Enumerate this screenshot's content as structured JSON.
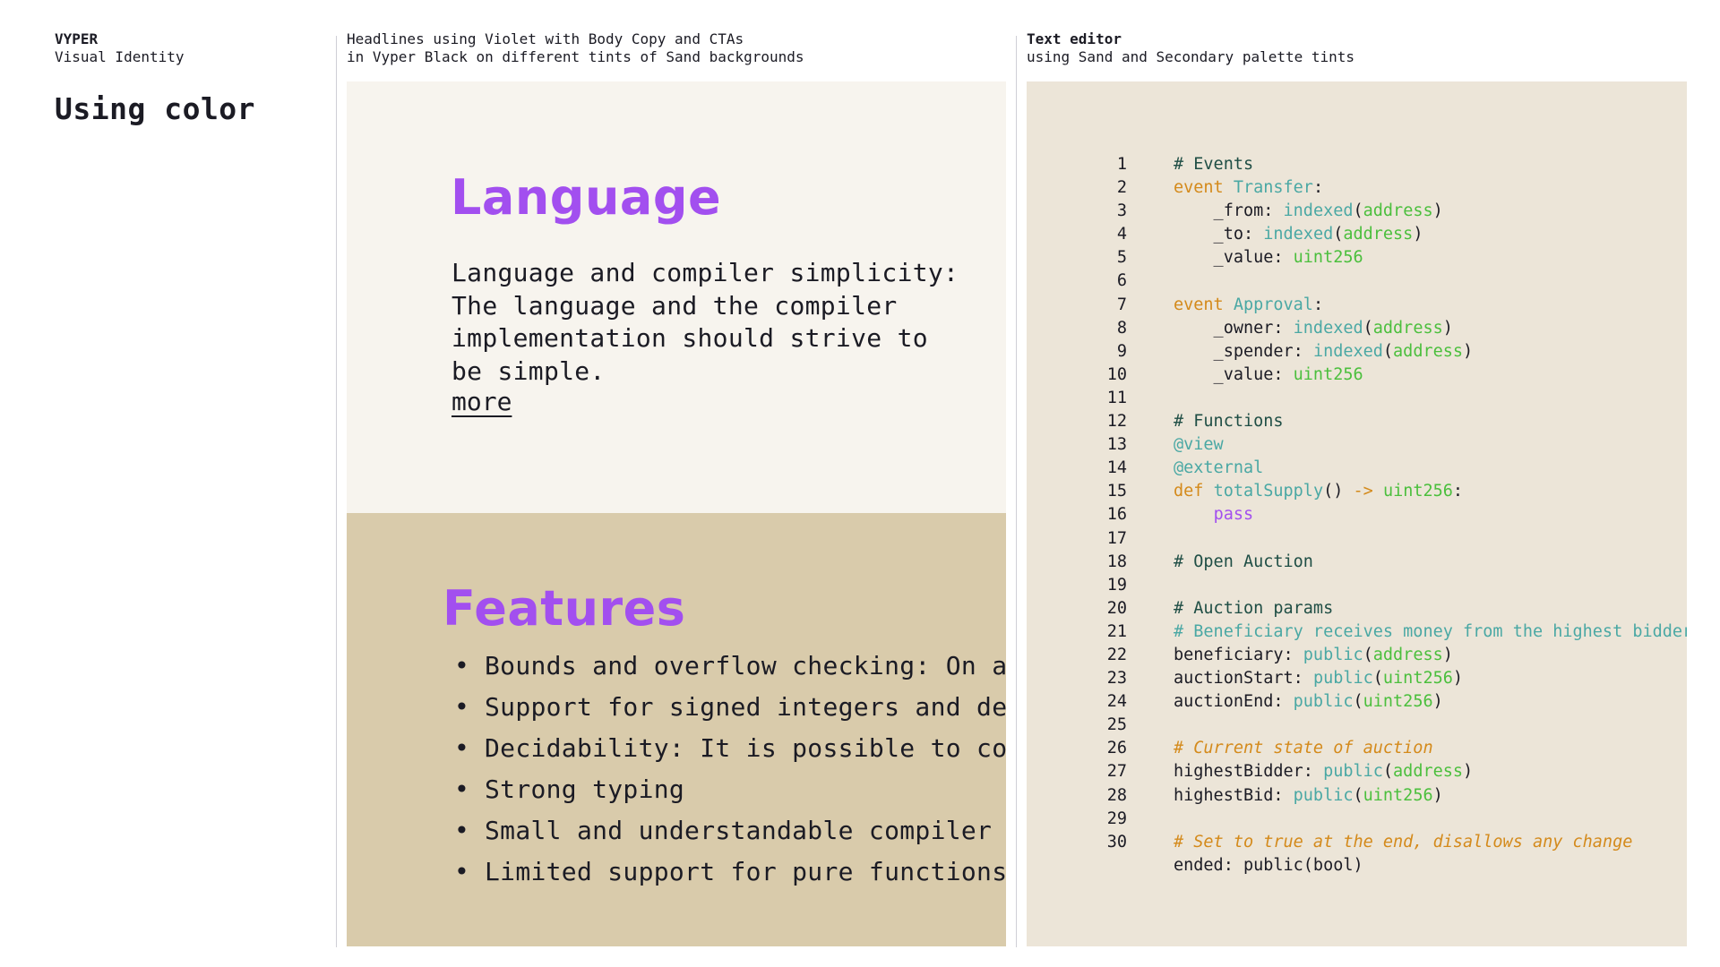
{
  "brand": {
    "name": "VYPER",
    "subtitle": "Visual Identity"
  },
  "page_title": "Using color",
  "middle": {
    "caption_line1": "Headlines using Violet with Body Copy and CTAs",
    "caption_line2": "in Vyper Black on different tints of Sand backgrounds",
    "language": {
      "heading": "Language",
      "body": "Language and compiler simplicity: The language and the compiler implementation should strive to be simple.",
      "more_label": "more"
    },
    "features": {
      "heading": "Features",
      "bullet": "•",
      "items": [
        "Bounds and overflow checking: On ar",
        "Support for signed integers and dec",
        "Decidability: It is possible to com",
        "Strong typing",
        "Small and understandable compiler c",
        "Limited support for pure functions:"
      ]
    }
  },
  "right": {
    "caption_line1": "Text editor",
    "caption_line2": "using Sand and Secondary palette tints"
  },
  "code": {
    "lines": [
      {
        "n": "1",
        "tokens": [
          [
            "c",
            "# Events"
          ]
        ]
      },
      {
        "n": "2",
        "tokens": [
          [
            "k",
            "event "
          ],
          [
            "n",
            "Transfer"
          ],
          [
            "p",
            ":"
          ]
        ]
      },
      {
        "n": "3",
        "tokens": [
          [
            "p",
            "    _from: "
          ],
          [
            "n",
            "indexed"
          ],
          [
            "p",
            "("
          ],
          [
            "t",
            "address"
          ],
          [
            "p",
            ")"
          ]
        ]
      },
      {
        "n": "4",
        "tokens": [
          [
            "p",
            "    _to: "
          ],
          [
            "n",
            "indexed"
          ],
          [
            "p",
            "("
          ],
          [
            "t",
            "address"
          ],
          [
            "p",
            ")"
          ]
        ]
      },
      {
        "n": "5",
        "tokens": [
          [
            "p",
            "    _value: "
          ],
          [
            "t",
            "uint256"
          ]
        ]
      },
      {
        "n": "6",
        "tokens": []
      },
      {
        "n": "7",
        "tokens": [
          [
            "k",
            "event "
          ],
          [
            "n",
            "Approval"
          ],
          [
            "p",
            ":"
          ]
        ]
      },
      {
        "n": "8",
        "tokens": [
          [
            "p",
            "    _owner: "
          ],
          [
            "n",
            "indexed"
          ],
          [
            "p",
            "("
          ],
          [
            "t",
            "address"
          ],
          [
            "p",
            ")"
          ]
        ]
      },
      {
        "n": "9",
        "tokens": [
          [
            "p",
            "    _spender: "
          ],
          [
            "n",
            "indexed"
          ],
          [
            "p",
            "("
          ],
          [
            "t",
            "address"
          ],
          [
            "p",
            ")"
          ]
        ]
      },
      {
        "n": "10",
        "tokens": [
          [
            "p",
            "    _value: "
          ],
          [
            "t",
            "uint256"
          ]
        ]
      },
      {
        "n": "11",
        "tokens": []
      },
      {
        "n": "12",
        "tokens": [
          [
            "c",
            "# Functions"
          ]
        ]
      },
      {
        "n": "13",
        "tokens": [
          [
            "d",
            "@view"
          ]
        ]
      },
      {
        "n": "14",
        "tokens": [
          [
            "d",
            "@external"
          ]
        ]
      },
      {
        "n": "15",
        "tokens": [
          [
            "k",
            "def "
          ],
          [
            "n",
            "totalSupply"
          ],
          [
            "p",
            "() "
          ],
          [
            "k",
            "-> "
          ],
          [
            "t",
            "uint256"
          ],
          [
            "p",
            ":"
          ]
        ]
      },
      {
        "n": "16",
        "tokens": [
          [
            "p",
            "    "
          ],
          [
            "v",
            "pass"
          ]
        ]
      },
      {
        "n": "17",
        "tokens": []
      },
      {
        "n": "18",
        "tokens": [
          [
            "c",
            "# Open Auction"
          ]
        ]
      },
      {
        "n": "19",
        "tokens": []
      },
      {
        "n": "20",
        "tokens": [
          [
            "c",
            "# Auction params"
          ]
        ]
      },
      {
        "n": "21",
        "tokens": [
          [
            "ct",
            "# Beneficiary receives money from the highest bidder"
          ]
        ]
      },
      {
        "n": "22",
        "tokens": [
          [
            "p",
            "beneficiary: "
          ],
          [
            "n",
            "public"
          ],
          [
            "p",
            "("
          ],
          [
            "t",
            "address"
          ],
          [
            "p",
            ")"
          ]
        ]
      },
      {
        "n": "23",
        "tokens": [
          [
            "p",
            "auctionStart: "
          ],
          [
            "n",
            "public"
          ],
          [
            "p",
            "("
          ],
          [
            "t",
            "uint256"
          ],
          [
            "p",
            ")"
          ]
        ]
      },
      {
        "n": "24",
        "tokens": [
          [
            "p",
            "auctionEnd: "
          ],
          [
            "n",
            "public"
          ],
          [
            "p",
            "("
          ],
          [
            "t",
            "uint256"
          ],
          [
            "p",
            ")"
          ]
        ]
      },
      {
        "n": "25",
        "tokens": []
      },
      {
        "n": "26",
        "tokens": [
          [
            "co",
            "# Current state of auction"
          ]
        ]
      },
      {
        "n": "27",
        "tokens": [
          [
            "p",
            "highestBidder: "
          ],
          [
            "n",
            "public"
          ],
          [
            "p",
            "("
          ],
          [
            "t",
            "address"
          ],
          [
            "p",
            ")"
          ]
        ]
      },
      {
        "n": "28",
        "tokens": [
          [
            "p",
            "highestBid: "
          ],
          [
            "n",
            "public"
          ],
          [
            "p",
            "("
          ],
          [
            "t",
            "uint256"
          ],
          [
            "p",
            ")"
          ]
        ]
      },
      {
        "n": "29",
        "tokens": []
      },
      {
        "n": "30",
        "tokens": [
          [
            "co",
            "# Set to true at the end, disallows any change"
          ]
        ]
      },
      {
        "n": "",
        "tokens": [
          [
            "p",
            "ended: public(bool)"
          ]
        ]
      }
    ]
  }
}
